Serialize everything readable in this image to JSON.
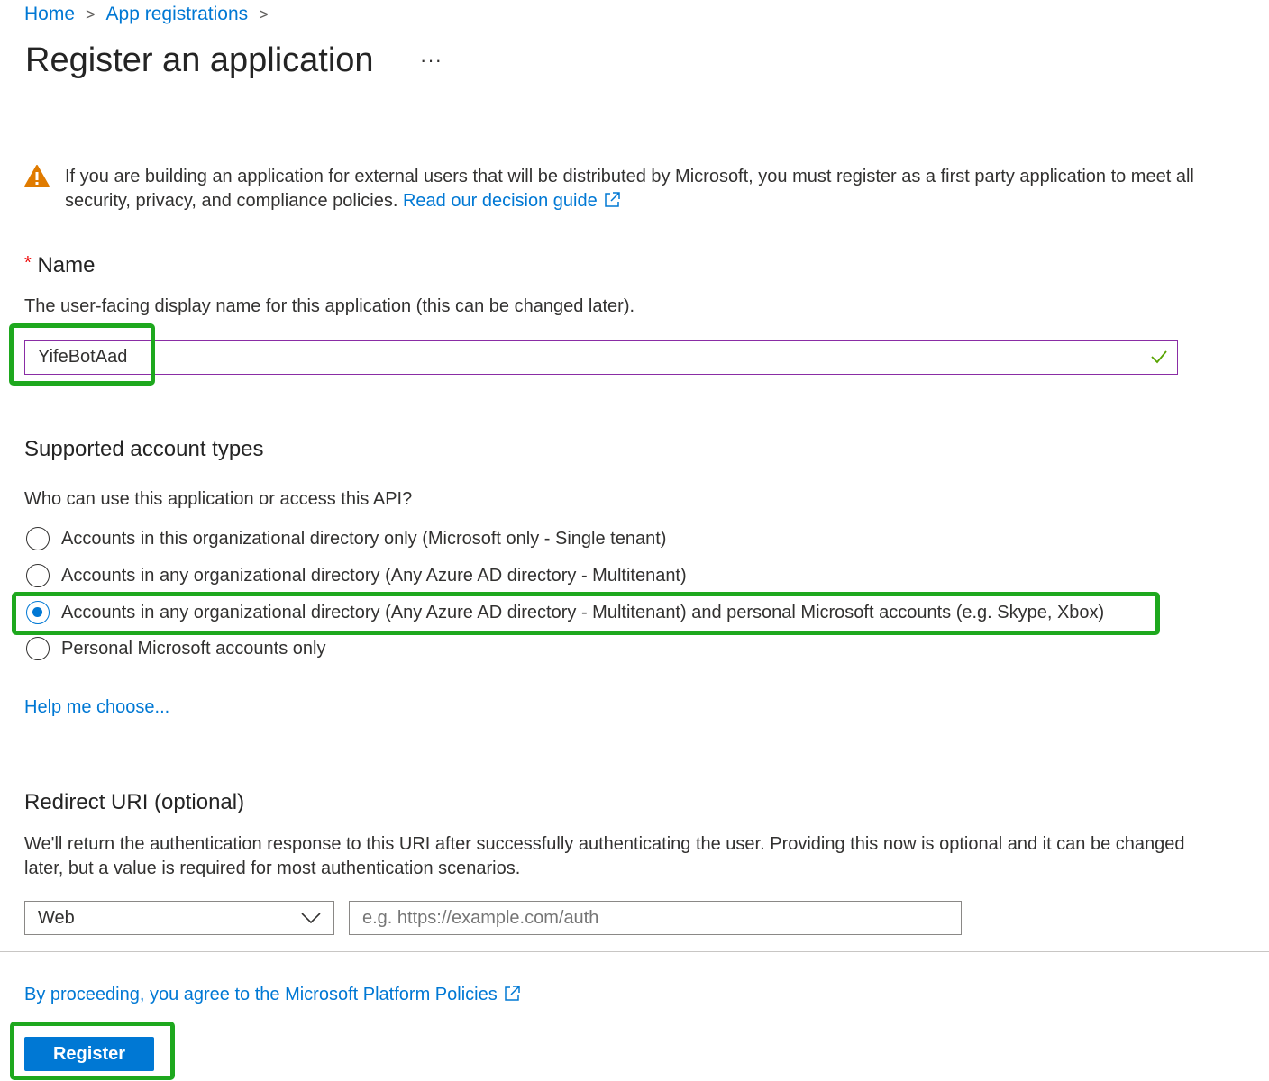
{
  "breadcrumb": [
    {
      "label": "Home"
    },
    {
      "label": "App registrations"
    }
  ],
  "page": {
    "title": "Register an application",
    "more_label": "···"
  },
  "warning": {
    "icon": "warning-icon",
    "text": "If you are building an application for external users that will be distributed by Microsoft, you must register as a first party application to meet all security, privacy, and compliance policies.",
    "link": "Read our decision guide"
  },
  "name": {
    "required_mark": "*",
    "label": "Name",
    "description": "The user-facing display name for this application (this can be changed later).",
    "value": "YifeBotAad",
    "valid_icon": "checkmark-icon"
  },
  "account_types": {
    "heading": "Supported account types",
    "question": "Who can use this application or access this API?",
    "options": [
      {
        "label": "Accounts in this organizational directory only (Microsoft only - Single tenant)",
        "selected": false
      },
      {
        "label": "Accounts in any organizational directory (Any Azure AD directory - Multitenant)",
        "selected": false
      },
      {
        "label": "Accounts in any organizational directory (Any Azure AD directory - Multitenant) and personal Microsoft accounts (e.g. Skype, Xbox)",
        "selected": true
      },
      {
        "label": "Personal Microsoft accounts only",
        "selected": false
      }
    ],
    "help_link": "Help me choose..."
  },
  "redirect": {
    "heading": "Redirect URI (optional)",
    "description": "We'll return the authentication response to this URI after successfully authenticating the user. Providing this now is optional and it can be changed later, but a value is required for most authentication scenarios.",
    "platform": "Web",
    "uri_placeholder": "e.g. https://example.com/auth"
  },
  "footer": {
    "policy_link": "By proceeding, you agree to the Microsoft Platform Policies",
    "register_label": "Register"
  },
  "colors": {
    "accent": "#0078d4",
    "highlight": "#1ea81e",
    "valid": "#57a300"
  }
}
